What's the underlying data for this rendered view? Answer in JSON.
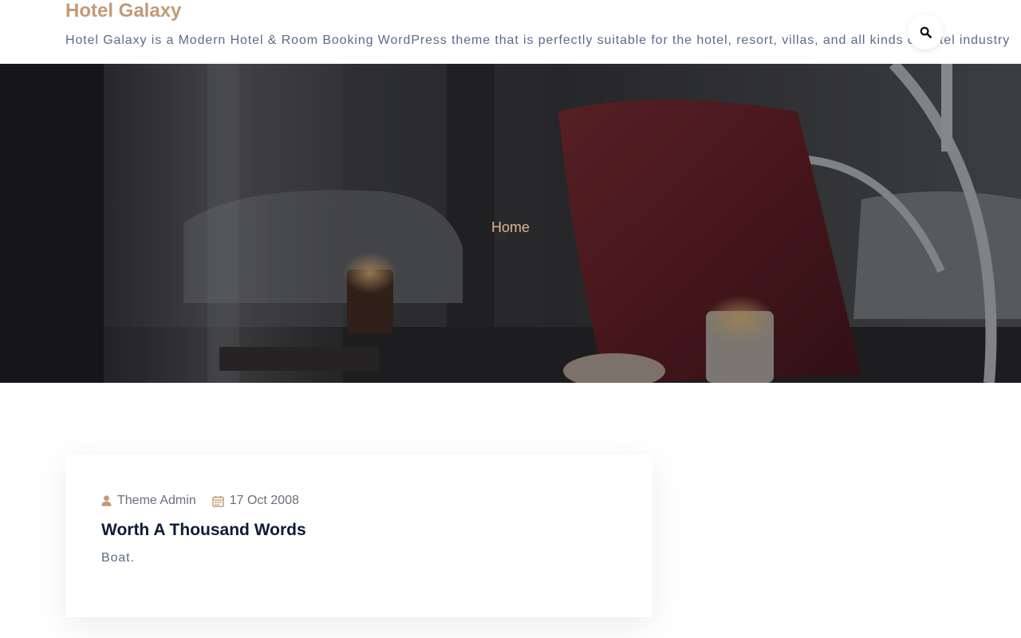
{
  "header": {
    "site_title": "Hotel Galaxy",
    "tagline": "Hotel Galaxy is a Modern Hotel & Room Booking WordPress theme that is perfectly suitable for the hotel, resort, villas, and all kinds of hotel industry",
    "search_icon": "search-icon"
  },
  "hero": {
    "breadcrumb": "Home"
  },
  "post": {
    "author": "Theme Admin",
    "author_icon": "user-icon",
    "date": "17 Oct 2008",
    "date_icon": "calendar-icon",
    "title": "Worth A Thousand Words",
    "excerpt": "Boat."
  },
  "colors": {
    "accent": "#c19b76",
    "heading": "#0f1a35",
    "text": "#5c6b8a"
  }
}
